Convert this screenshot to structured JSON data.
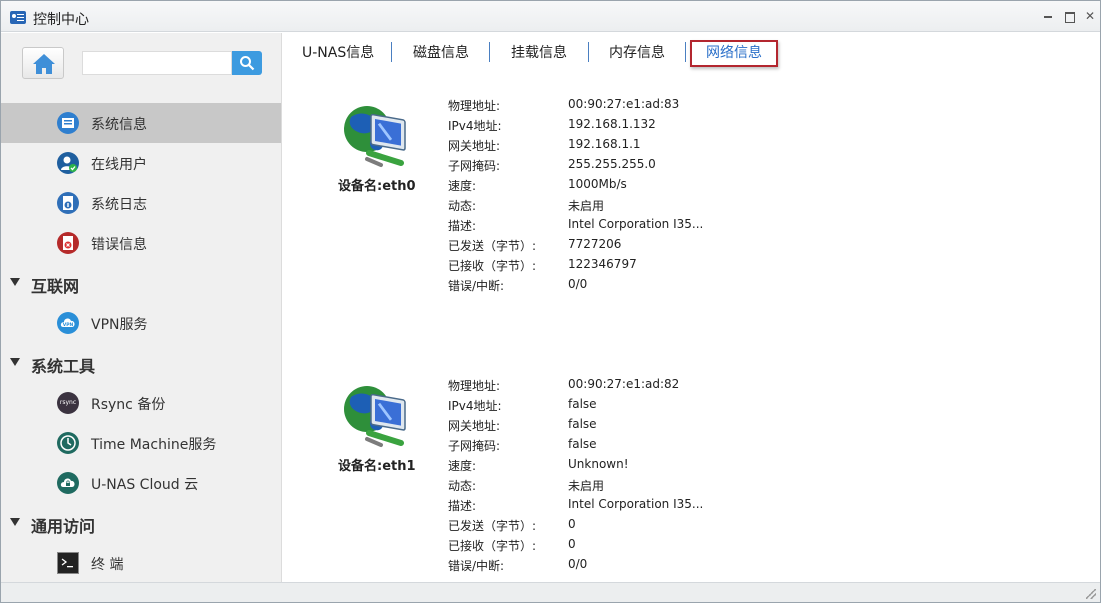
{
  "window": {
    "title": "控制中心"
  },
  "search": {
    "placeholder": ""
  },
  "sidebar": {
    "items": [
      {
        "label": "系统信息",
        "active": true,
        "icon": "system-info-icon"
      },
      {
        "label": "在线用户",
        "icon": "online-users-icon"
      },
      {
        "label": "系统日志",
        "icon": "system-log-icon"
      },
      {
        "label": "错误信息",
        "icon": "error-info-icon"
      }
    ],
    "groups": [
      {
        "label": "互联网",
        "items": [
          {
            "label": "VPN服务",
            "icon": "vpn-icon"
          }
        ]
      },
      {
        "label": "系统工具",
        "items": [
          {
            "label": "Rsync 备份",
            "icon": "rsync-icon",
            "icon_text": "rsync"
          },
          {
            "label": "Time Machine服务",
            "icon": "time-machine-icon"
          },
          {
            "label": "U-NAS Cloud 云",
            "icon": "cloud-icon"
          }
        ]
      },
      {
        "label": "通用访问",
        "items": [
          {
            "label": "终 端",
            "icon": "terminal-icon"
          }
        ]
      }
    ]
  },
  "tabs": [
    {
      "label": "U-NAS信息"
    },
    {
      "label": "磁盘信息"
    },
    {
      "label": "挂载信息"
    },
    {
      "label": "内存信息"
    },
    {
      "label": "网络信息",
      "active": true
    }
  ],
  "devices": [
    {
      "name": "设备名:eth0",
      "rows": [
        {
          "k": "物理地址:",
          "v": "00:90:27:e1:ad:83"
        },
        {
          "k": "IPv4地址:",
          "v": "192.168.1.132"
        },
        {
          "k": "网关地址:",
          "v": "192.168.1.1"
        },
        {
          "k": "子网掩码:",
          "v": "255.255.255.0"
        },
        {
          "k": "速度:",
          "v": "1000Mb/s"
        },
        {
          "k": "动态:",
          "v": "未启用"
        },
        {
          "k": "描述:",
          "v": "Intel Corporation I35..."
        },
        {
          "k": "已发送（字节）:",
          "v": "7727206"
        },
        {
          "k": "已接收（字节）:",
          "v": "122346797"
        },
        {
          "k": "错误/中断:",
          "v": "0/0"
        }
      ]
    },
    {
      "name": "设备名:eth1",
      "rows": [
        {
          "k": "物理地址:",
          "v": "00:90:27:e1:ad:82"
        },
        {
          "k": "IPv4地址:",
          "v": "false"
        },
        {
          "k": "网关地址:",
          "v": "false"
        },
        {
          "k": "子网掩码:",
          "v": "false"
        },
        {
          "k": "速度:",
          "v": "Unknown!"
        },
        {
          "k": "动态:",
          "v": "未启用"
        },
        {
          "k": "描述:",
          "v": "Intel Corporation I35..."
        },
        {
          "k": "已发送（字节）:",
          "v": "0"
        },
        {
          "k": "已接收（字节）:",
          "v": "0"
        },
        {
          "k": "错误/中断:",
          "v": "0/0"
        }
      ]
    }
  ],
  "colors": {
    "accent": "#2a6fc9",
    "active_tab_border": "#b3262f",
    "search_button": "#3d9be0",
    "sidebar_active": "#c8c8c8"
  }
}
